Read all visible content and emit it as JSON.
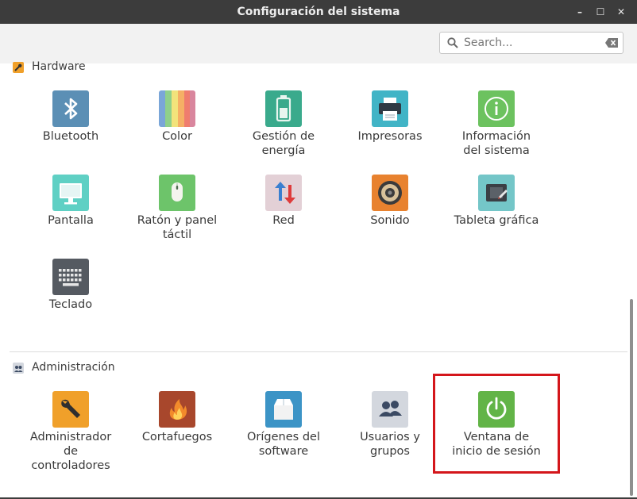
{
  "window": {
    "title": "Configuración del sistema",
    "controls": {
      "minimize": "–",
      "maximize": "☐",
      "close": "✕"
    }
  },
  "search": {
    "placeholder": "Search..."
  },
  "sections": {
    "hardware": {
      "title": "Hardware",
      "items": [
        {
          "label": "Bluetooth",
          "icon": "bluetooth-icon"
        },
        {
          "label": "Color",
          "icon": "color-icon"
        },
        {
          "label": "Gestión de\nenergía",
          "icon": "battery-icon"
        },
        {
          "label": "Impresoras",
          "icon": "printer-icon"
        },
        {
          "label": "Información\ndel sistema",
          "icon": "info-icon"
        },
        {
          "label": "Pantalla",
          "icon": "monitor-icon"
        },
        {
          "label": "Ratón y panel\ntáctil",
          "icon": "mouse-icon"
        },
        {
          "label": "Red",
          "icon": "network-icon"
        },
        {
          "label": "Sonido",
          "icon": "speaker-icon"
        },
        {
          "label": "Tableta gráfica",
          "icon": "tablet-icon"
        },
        {
          "label": "Teclado",
          "icon": "keyboard-icon"
        }
      ]
    },
    "administration": {
      "title": "Administración",
      "items": [
        {
          "label": "Administrador\nde\ncontroladores",
          "icon": "wrench-icon"
        },
        {
          "label": "Cortafuegos",
          "icon": "firewall-icon"
        },
        {
          "label": "Orígenes del\nsoftware",
          "icon": "package-icon"
        },
        {
          "label": "Usuarios y\ngrupos",
          "icon": "users-icon"
        },
        {
          "label": "Ventana de\ninicio de sesión",
          "icon": "power-icon",
          "highlighted": true
        }
      ]
    }
  },
  "colors": {
    "titlebar": "#3c3c3c",
    "highlight_box": "#d4161b",
    "bluetooth": "#5b8fb5",
    "battery": "#3aaa8c",
    "printer": "#41b4c6",
    "info": "#6cc25f",
    "monitor": "#5fd0c4",
    "mouse": "#6dc46a",
    "network": "#e3d0d6",
    "speaker": "#e8822f",
    "tablet": "#74c6c8",
    "keyboard": "#555a61",
    "wrench": "#f0a02a",
    "firewall": "#a8472c",
    "package": "#3c94c6",
    "users": "#d3d7de",
    "power": "#62b447"
  }
}
